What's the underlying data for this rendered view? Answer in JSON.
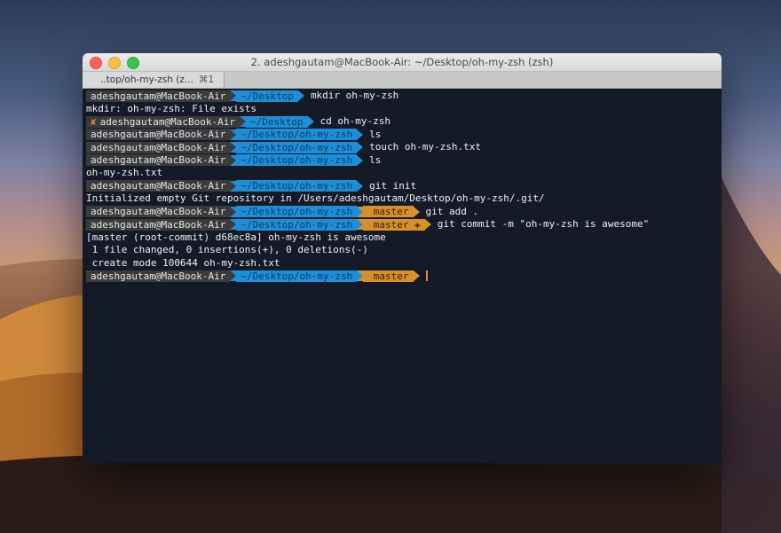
{
  "window": {
    "title": "2. adeshgautam@MacBook-Air: ~/Desktop/oh-my-zsh (zsh)",
    "tab_label": "..top/oh-my-zsh (z...",
    "tab_shortcut": "⌘1"
  },
  "prompt": {
    "user": "adeshgautam@MacBook-Air",
    "error_mark": "✘",
    "branch_icon": "",
    "branch_dirty_mark": "✚"
  },
  "lines": [
    {
      "dir": "~/Desktop",
      "cmd": "mkdir oh-my-zsh"
    },
    {
      "out": "mkdir: oh-my-zsh: File exists"
    },
    {
      "dir": "~/Desktop",
      "cmd": "cd oh-my-zsh",
      "error": true
    },
    {
      "dir": "~/Desktop/oh-my-zsh",
      "cmd": "ls"
    },
    {
      "dir": "~/Desktop/oh-my-zsh",
      "cmd": "touch oh-my-zsh.txt"
    },
    {
      "dir": "~/Desktop/oh-my-zsh",
      "cmd": "ls"
    },
    {
      "out": "oh-my-zsh.txt"
    },
    {
      "dir": "~/Desktop/oh-my-zsh",
      "cmd": "git init"
    },
    {
      "out": "Initialized empty Git repository in /Users/adeshgautam/Desktop/oh-my-zsh/.git/"
    },
    {
      "dir": "~/Desktop/oh-my-zsh",
      "branch": "master",
      "cmd": "git add ."
    },
    {
      "dir": "~/Desktop/oh-my-zsh",
      "branch": "master",
      "dirty": true,
      "cmd": "git commit -m \"oh-my-zsh is awesome\""
    },
    {
      "out": "[master (root-commit) d68ec8a] oh-my-zsh is awesome"
    },
    {
      "out": " 1 file changed, 0 insertions(+), 0 deletions(-)"
    },
    {
      "out": " create mode 100644 oh-my-zsh.txt"
    },
    {
      "dir": "~/Desktop/oh-my-zsh",
      "branch": "master",
      "cursor": true
    }
  ],
  "colors": {
    "terminal_bg": "#141a27",
    "user_segment": "#3b3b3b",
    "dir_segment": "#1d8fd9",
    "git_segment": "#d9902a"
  }
}
